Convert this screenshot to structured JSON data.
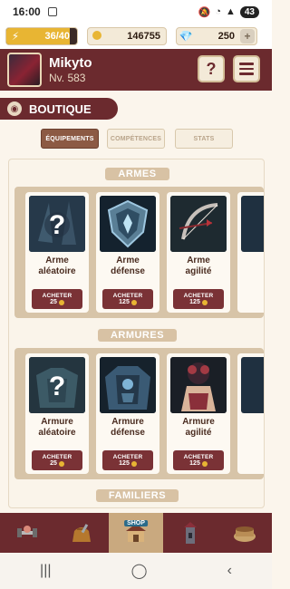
{
  "statusbar": {
    "time": "16:00",
    "battery": "43"
  },
  "resources": {
    "energy": {
      "text": "36/40",
      "fraction": 0.9
    },
    "gold": "146755",
    "gems": "250",
    "gems_plus": "+"
  },
  "player": {
    "name": "Mikyto",
    "level": "Nv. 583",
    "help_label": "?"
  },
  "boutique": {
    "title": "BOUTIQUE"
  },
  "tabs": [
    {
      "label": "ÉQUIPEMENTS"
    },
    {
      "label": "COMPÉTENCES"
    },
    {
      "label": "STATS"
    }
  ],
  "sections": [
    {
      "title": "ARMES",
      "items": [
        {
          "name_line1": "Arme",
          "name_line2": "aléatoire",
          "buy_label": "ACHETER",
          "price": "25"
        },
        {
          "name_line1": "Arme",
          "name_line2": "défense",
          "buy_label": "ACHETER",
          "price": "125"
        },
        {
          "name_line1": "Arme",
          "name_line2": "agilité",
          "buy_label": "ACHETER",
          "price": "125"
        }
      ]
    },
    {
      "title": "ARMURES",
      "items": [
        {
          "name_line1": "Armure",
          "name_line2": "aléatoire",
          "buy_label": "ACHETER",
          "price": "25"
        },
        {
          "name_line1": "Armure",
          "name_line2": "défense",
          "buy_label": "ACHETER",
          "price": "125"
        },
        {
          "name_line1": "Armure",
          "name_line2": "agilité",
          "buy_label": "ACHETER",
          "price": "125"
        }
      ]
    },
    {
      "title": "FAMILIERS"
    }
  ],
  "bottomnav": {
    "shop_label": "SHOP"
  },
  "colors": {
    "primary": "#6b2a2e",
    "accent": "#e8b533",
    "active_tab": "#8c5a44"
  }
}
